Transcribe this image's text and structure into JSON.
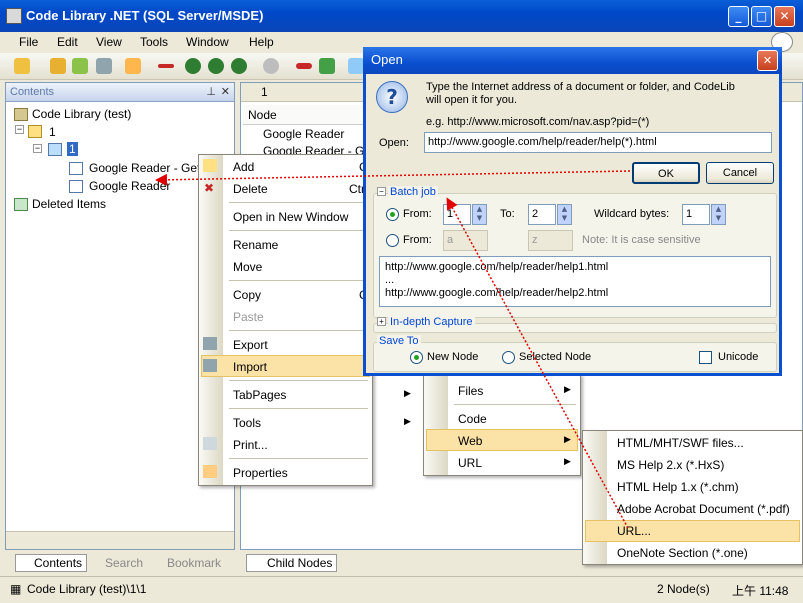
{
  "window": {
    "title": "Code Library .NET (SQL Server/MSDE)"
  },
  "menubar": {
    "items": [
      "File",
      "Edit",
      "View",
      "Tools",
      "Window",
      "Help"
    ]
  },
  "left_panel": {
    "title": "Contents",
    "tree": {
      "root": "Code Library (test)",
      "n1": "1",
      "n11": "1",
      "leaf1": "Google Reader - Gett",
      "leaf2": "Google Reader",
      "deleted": "Deleted Items"
    },
    "tabs": [
      "Contents",
      "Search",
      "Bookmark"
    ]
  },
  "right_panel": {
    "tab_label": "1",
    "column": "Node",
    "rows": [
      "Google Reader",
      "Google Reader - Ge"
    ],
    "bottom_tab": "Child Nodes"
  },
  "context_menu": {
    "items": {
      "add": "Add",
      "delete": "Delete",
      "delete_shortcut": "Ctr",
      "open_new": "Open in New Window",
      "rename": "Rename",
      "move": "Move",
      "copy": "Copy",
      "copy_shortcut": "C",
      "paste": "Paste",
      "export": "Export",
      "import": "Import",
      "tabpages": "TabPages",
      "tools": "Tools",
      "print": "Print...",
      "properties": "Properties",
      "add_shortcut": "C"
    }
  },
  "submenu_import": {
    "items": [
      "Files",
      "Code",
      "Web",
      "URL"
    ]
  },
  "submenu_web": {
    "items": [
      "HTML/MHT/SWF files...",
      "MS Help 2.x (*.HxS)",
      "HTML Help 1.x (*.chm)",
      "Adobe Acrobat Document (*.pdf)",
      "URL...",
      "OneNote Section (*.one)"
    ]
  },
  "dialog": {
    "title": "Open",
    "message_line1": "Type the Internet address of a document or folder, and CodeLib",
    "message_line2": "will open it for you.",
    "example": "e.g. http://www.microsoft.com/nav.asp?pid=(*)",
    "open_label": "Open:",
    "open_value": "http://www.google.com/help/reader/help(*).html",
    "ok": "OK",
    "cancel": "Cancel",
    "batch_label": "Batch job",
    "from_label": "From:",
    "from_value": "1",
    "to_label": "To:",
    "to_value": "2",
    "wildcard_label": "Wildcard bytes:",
    "wildcard_value": "1",
    "from2_label": "From:",
    "from2_value": "a",
    "to2_value": "z",
    "note": "Note: It is case sensitive",
    "preview_line1": "http://www.google.com/help/reader/help1.html",
    "preview_line2": "...",
    "preview_line3": "http://www.google.com/help/reader/help2.html",
    "indepth_label": "In-depth Capture",
    "saveto_label": "Save To",
    "new_node": "New Node",
    "selected_node": "Selected Node",
    "unicode": "Unicode"
  },
  "statusbar": {
    "path": "Code Library (test)\\1\\1",
    "count": "2 Node(s)",
    "time": "上午 11:48"
  },
  "colors": {
    "highlight": "#fbe3a8",
    "title_blue": "#0a4fd0",
    "arrow_red": "#e00000"
  }
}
